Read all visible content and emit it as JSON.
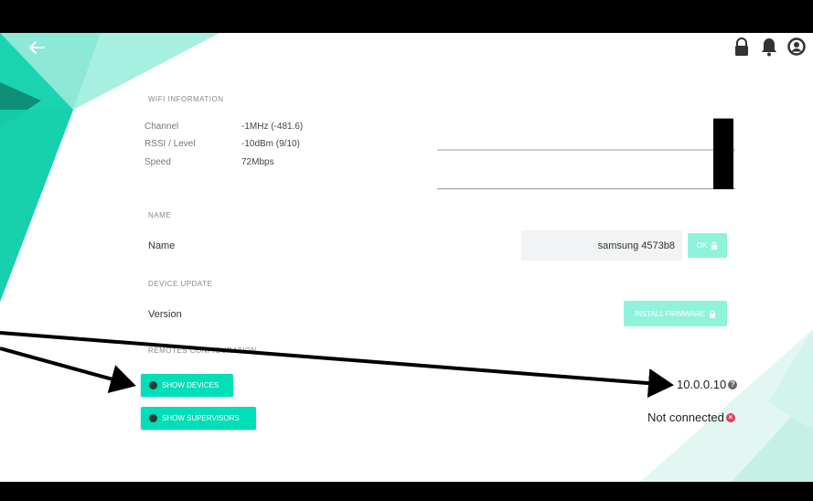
{
  "wifi": {
    "section_title": "WIFI INFORMATION",
    "rows": [
      {
        "label": "Channel",
        "value": "-1MHz (-481.6)"
      },
      {
        "label": "RSSI / Level",
        "value": "-10dBm (9/10)"
      },
      {
        "label": "Speed",
        "value": "72Mbps"
      }
    ],
    "signal_level": 0.9
  },
  "name": {
    "section_title": "NAME",
    "label": "Name",
    "value": "samsung 4573b8",
    "ok_label": "OK"
  },
  "device_update": {
    "section_title": "DEVICE UPDATE",
    "label": "Version",
    "install_label": "INSTALL FIRMWARE"
  },
  "remotes": {
    "section_title": "REMOTES CONFIGURATION",
    "show_devices_label": "SHOW DEVICES",
    "show_supervisors_label": "SHOW SUPERVISORS",
    "ip": "10.0.0.10",
    "ip_icon": "?",
    "status": "Not connected",
    "status_icon": "×"
  },
  "colors": {
    "accent": "#00dfb7",
    "accent_disabled": "#8ff3dc",
    "error": "#e53d5b"
  },
  "icons": [
    "back-arrow-icon",
    "lock-icon",
    "bell-icon",
    "account-icon"
  ]
}
